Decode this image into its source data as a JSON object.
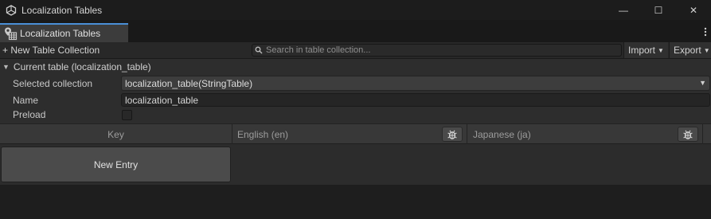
{
  "window": {
    "title": "Localization Tables",
    "controls": {
      "minimize": "—",
      "maximize": "☐",
      "close": "✕"
    }
  },
  "tab": {
    "label": "Localization Tables",
    "menu_glyph": "⋮"
  },
  "toolbar": {
    "new_collection_label": "+ New Table Collection",
    "search_placeholder": "Search in table collection...",
    "import_label": "Import",
    "export_label": "Export"
  },
  "current_table": {
    "header": "Current table (localization_table)",
    "selected_collection_label": "Selected collection",
    "selected_collection_value": "localization_table(StringTable)",
    "name_label": "Name",
    "name_value": "localization_table",
    "preload_label": "Preload",
    "preload_checked": false
  },
  "table": {
    "columns": [
      "Key",
      "English (en)",
      "Japanese (ja)"
    ],
    "new_entry_label": "New Entry"
  },
  "icons": {
    "app": "unity-cube-icon",
    "tab": "localization-tables-icon",
    "search": "search-icon",
    "locale_inspector": "locale-bug-icon"
  },
  "colors": {
    "accent": "#4a8fd6",
    "background": "#1e1e1e",
    "panel": "#2d2d2d"
  }
}
